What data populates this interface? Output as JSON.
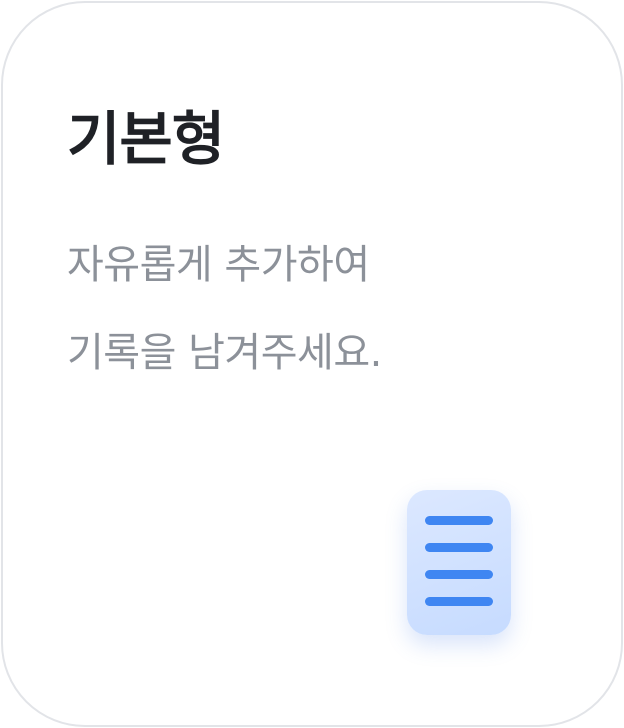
{
  "card": {
    "title": "기본형",
    "description_lines": [
      "자유롭게 추가하여",
      "기록을 남겨주세요."
    ]
  },
  "icon": {
    "name": "document-lines-icon",
    "accent_color": "#3f86f2",
    "background_color": "#d4e4ff"
  },
  "colors": {
    "title": "#1f2126",
    "description": "#8c9199",
    "border": "#e2e4e8"
  }
}
